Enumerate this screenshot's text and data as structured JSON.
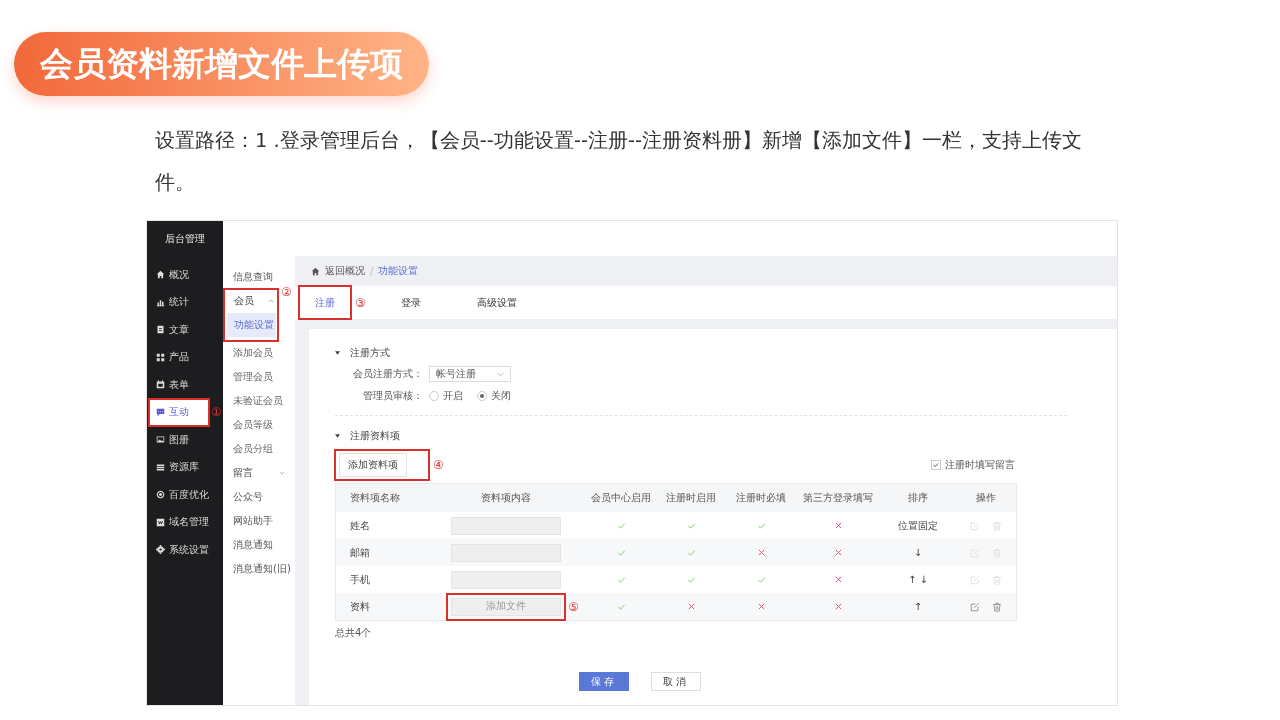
{
  "slide_title": "会员资料新增文件上传项",
  "description": "设置路径：1 .登录管理后台，【会员--功能设置--注册--注册资料册】新增【添加文件】一栏，支持上传文件。",
  "admin": {
    "brand": "后台管理",
    "nav": [
      {
        "label": "概况",
        "selected": false
      },
      {
        "label": "统计",
        "selected": false
      },
      {
        "label": "文章",
        "selected": false
      },
      {
        "label": "产品",
        "selected": false
      },
      {
        "label": "表单",
        "selected": false
      },
      {
        "label": "互动",
        "selected": true,
        "callout": "①"
      },
      {
        "label": "图册",
        "selected": false
      },
      {
        "label": "资源库",
        "selected": false
      },
      {
        "label": "百度优化",
        "selected": false
      },
      {
        "label": "域名管理",
        "selected": false
      },
      {
        "label": "系统设置",
        "selected": false
      }
    ],
    "subnav": [
      {
        "kind": "item",
        "label": "信息查询",
        "selected": false
      },
      {
        "kind": "group",
        "label": "会员",
        "expanded": true,
        "callout": "②",
        "children": [
          {
            "label": "功能设置",
            "selected": true
          },
          {
            "label": "添加会员",
            "selected": false
          },
          {
            "label": "管理会员",
            "selected": false
          },
          {
            "label": "未验证会员",
            "selected": false
          },
          {
            "label": "会员等级",
            "selected": false
          },
          {
            "label": "会员分组",
            "selected": false
          }
        ]
      },
      {
        "kind": "group",
        "label": "留言",
        "expanded": false
      },
      {
        "kind": "item",
        "label": "公众号",
        "selected": false
      },
      {
        "kind": "item",
        "label": "网站助手",
        "selected": false
      },
      {
        "kind": "item",
        "label": "消息通知",
        "selected": false
      },
      {
        "kind": "item",
        "label": "消息通知(旧)",
        "selected": false
      }
    ],
    "breadcrumb": [
      "返回概况",
      "功能设置"
    ],
    "breadcrumb_separator": "/",
    "tabs": [
      {
        "label": "注册",
        "selected": true,
        "callout": "③"
      },
      {
        "label": "登录",
        "selected": false
      },
      {
        "label": "高级设置",
        "selected": false
      }
    ],
    "register_method": {
      "heading": "注册方式",
      "method_label": "会员注册方式：",
      "method_value": "帐号注册",
      "review_label": "管理员审核：",
      "review_options": [
        {
          "label": "开启",
          "selected": false
        },
        {
          "label": "关闭",
          "selected": true
        }
      ]
    },
    "profile": {
      "heading": "注册资料项",
      "add_button": {
        "label": "添加资料项",
        "callout": "④"
      },
      "leave_message": {
        "label": "注册时填写留言",
        "checked": true
      },
      "columns": [
        "资料项名称",
        "资料项内容",
        "会员中心启用",
        "注册时启用",
        "注册时必填",
        "第三方登录填写",
        "排序",
        "操作"
      ],
      "rows": [
        {
          "name": "姓名",
          "member_center": true,
          "on_register": true,
          "required": true,
          "third_party": false,
          "sort": "位置固定",
          "actions_enabled": false
        },
        {
          "name": "邮箱",
          "member_center": true,
          "on_register": true,
          "required": false,
          "third_party": false,
          "sort": "↓",
          "actions_enabled": false
        },
        {
          "name": "手机",
          "member_center": true,
          "on_register": true,
          "required": true,
          "third_party": false,
          "sort": "↑ ↓",
          "actions_enabled": false
        },
        {
          "name": "资料",
          "content": {
            "text": "添加文件",
            "callout": "⑤"
          },
          "member_center": true,
          "on_register": false,
          "required": false,
          "third_party": false,
          "sort": "↑",
          "actions_enabled": true
        }
      ],
      "total": "总共4个"
    },
    "save": "保存",
    "cancel": "取消"
  }
}
